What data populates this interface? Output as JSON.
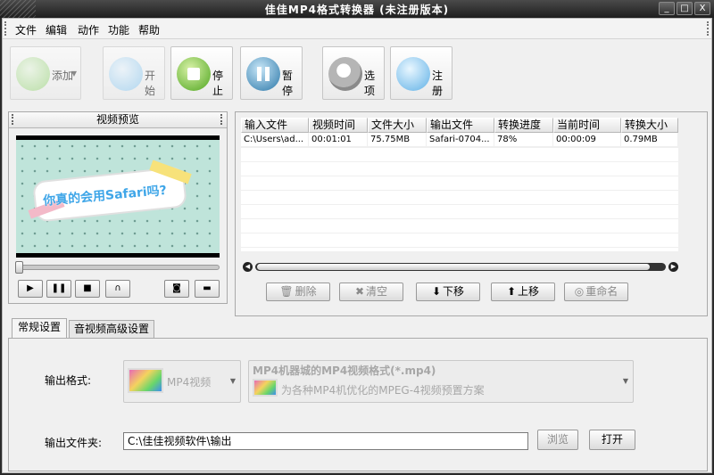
{
  "window": {
    "title": "佳佳MP4格式转换器  (未注册版本)",
    "controls": [
      "_",
      "□",
      "X"
    ]
  },
  "menu": [
    "文件",
    "编辑",
    "动作",
    "功能",
    "帮助"
  ],
  "toolbar": {
    "add": "添加",
    "start": "开始",
    "stop": "停止",
    "pause": "暂停",
    "options": "选项",
    "register": "注册"
  },
  "preview": {
    "title": "视频预览",
    "video_text": "你真的会用Safari吗?"
  },
  "table": {
    "columns": [
      "输入文件",
      "视频时间",
      "文件大小",
      "输出文件",
      "转换进度",
      "当前时间",
      "转换大小"
    ],
    "rows": [
      [
        "C:\\Users\\ad...",
        "00:01:01",
        "75.75MB",
        "Safari-0704...",
        "78%",
        "00:00:09",
        "0.79MB"
      ]
    ]
  },
  "actions": {
    "delete": "删除",
    "clear": "清空",
    "down": "下移",
    "up": "上移",
    "rename": "重命名"
  },
  "tabs": [
    "常规设置",
    "音视频高级设置"
  ],
  "settings": {
    "format_label": "输出格式:",
    "format_value": "MP4视频",
    "preset_title": "MP4机器城的MP4视频格式(*.mp4)",
    "preset_desc": "为各种MP4机优化的MPEG-4视频预置方案",
    "folder_label": "输出文件夹:",
    "folder_value": "C:\\佳佳视频软件\\输出",
    "browse": "浏览",
    "open": "打开"
  }
}
